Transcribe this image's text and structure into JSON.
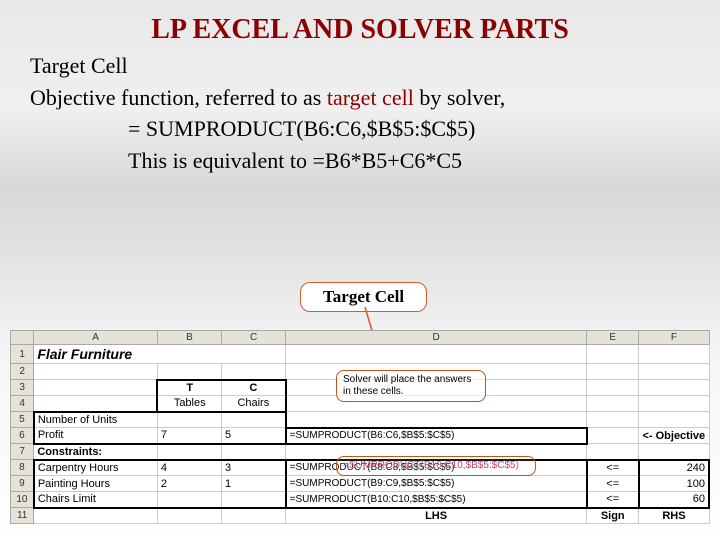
{
  "title": "LP EXCEL AND SOLVER PARTS",
  "body": {
    "line1a": "Target Cell",
    "line2a": "Objective function, referred to as ",
    "line2b": "target cell ",
    "line2c": "by solver,",
    "line3": "= SUMPRODUCT(B6:C6,$B$5:$C$5)",
    "line4": "This is equivalent to =B6*B5+C6*C5"
  },
  "callout": "Target Cell",
  "hint_solver_l1": "Solver will place the answers",
  "hint_solver_l2": "in these cells.",
  "hint_lower": "=SUMPRODUCT(B10:C10,$B$5:$C$5)",
  "sheet": {
    "headers": [
      "",
      "A",
      "B",
      "C",
      "D",
      "E",
      "F"
    ],
    "rows": [
      {
        "n": "1",
        "A": "Flair Furniture",
        "B": "",
        "C": "",
        "D": "",
        "E": "",
        "F": ""
      },
      {
        "n": "2",
        "A": "",
        "B": "",
        "C": "",
        "D": "",
        "E": "",
        "F": ""
      },
      {
        "n": "3",
        "A": "",
        "B": "T",
        "C": "C",
        "D": "",
        "E": "",
        "F": ""
      },
      {
        "n": "4",
        "A": "",
        "B": "Tables",
        "C": "Chairs",
        "D": "",
        "E": "",
        "F": ""
      },
      {
        "n": "5",
        "A": "Number of Units",
        "B": "",
        "C": "",
        "D": "",
        "E": "",
        "F": ""
      },
      {
        "n": "6",
        "A": "Profit",
        "B": "7",
        "C": "5",
        "D": "=SUMPRODUCT(B6:C6,$B$5:$C$5)",
        "E": "",
        "F": "<- Objective"
      },
      {
        "n": "7",
        "A": "Constraints:",
        "B": "",
        "C": "",
        "D": "",
        "E": "",
        "F": ""
      },
      {
        "n": "8",
        "A": "Carpentry Hours",
        "B": "4",
        "C": "3",
        "D": "=SUMPRODUCT(B8:C8,$B$5:$C$5)",
        "E": "<=",
        "F": "240"
      },
      {
        "n": "9",
        "A": "Painting Hours",
        "B": "2",
        "C": "1",
        "D": "=SUMPRODUCT(B9:C9,$B$5:$C$5)",
        "E": "<=",
        "F": "100"
      },
      {
        "n": "10",
        "A": "Chairs Limit",
        "B": "",
        "C": "",
        "D": "=SUMPRODUCT(B10:C10,$B$5:$C$5)",
        "E": "<=",
        "F": "60"
      },
      {
        "n": "11",
        "A": "",
        "B": "",
        "C": "",
        "D": "LHS",
        "E": "Sign",
        "F": "RHS"
      }
    ]
  }
}
